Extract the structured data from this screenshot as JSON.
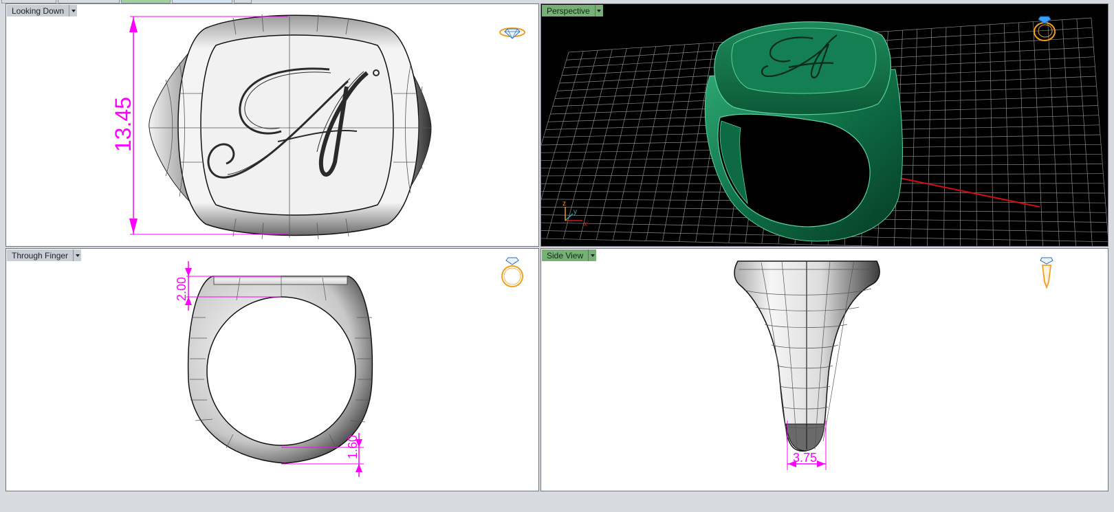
{
  "colors": {
    "dimension": "#ff00ff",
    "active_label": "#77b077",
    "inactive_label": "#c9ced6",
    "perspective_bg": "#000000",
    "ring_green": "#0f7a4f",
    "widget_orange": "#f0a020",
    "gizmo_blue": "#3aa0ff"
  },
  "viewports": {
    "top_left": {
      "label": "Looking Down",
      "dimension": "13.45",
      "widget_icon": "top-ring-view-icon"
    },
    "top_right": {
      "label": "Perspective",
      "widget_icon": "perspective-ring-view-icon",
      "axis_labels": {
        "x": "x",
        "y": "y",
        "z": "z"
      }
    },
    "bottom_left": {
      "label": "Through Finger",
      "dimension_top": "2.00",
      "dimension_bottom": "1.60",
      "widget_icon": "front-ring-view-icon"
    },
    "bottom_right": {
      "label": "Side View",
      "dimension": "3.75",
      "widget_icon": "side-ring-view-icon"
    }
  }
}
